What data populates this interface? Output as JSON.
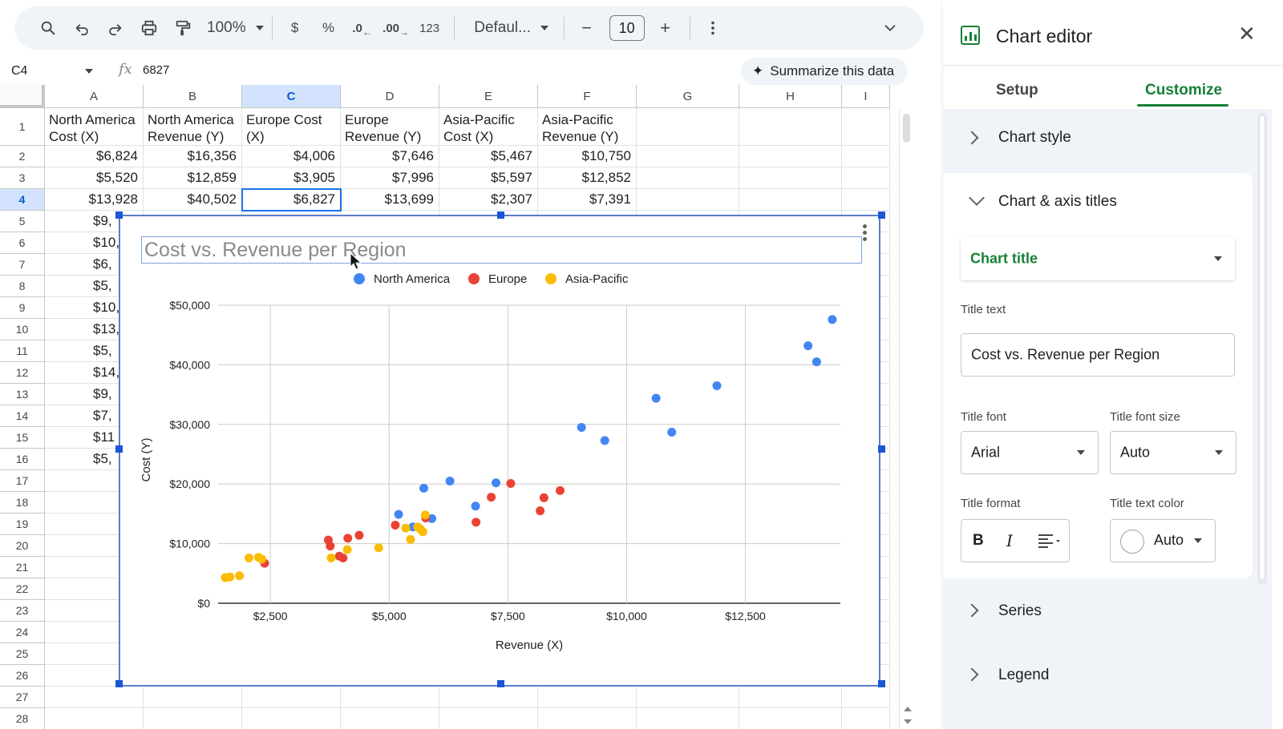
{
  "toolbar": {
    "zoom": "100%",
    "currency": "$",
    "percent": "%",
    "decrease_decimal": ".0",
    "increase_decimal": ".00",
    "number_format": "123",
    "font": "Defaul...",
    "font_size": "10",
    "minus": "−",
    "plus": "+"
  },
  "formula_bar": {
    "cell_ref": "C4",
    "fx": "fx",
    "value": "6827",
    "summarize": "Summarize this data"
  },
  "grid": {
    "columns": [
      "A",
      "B",
      "C",
      "D",
      "E",
      "F",
      "G",
      "H",
      "I"
    ],
    "rows": [
      "1",
      "2",
      "3",
      "4",
      "5",
      "6",
      "7",
      "8",
      "9",
      "10",
      "11",
      "12",
      "13",
      "14",
      "15",
      "16",
      "17",
      "18",
      "19",
      "20",
      "21",
      "22",
      "23",
      "24",
      "25",
      "26",
      "27",
      "28"
    ],
    "headers": [
      "North America Cost (X)",
      "North America Revenue (Y)",
      "Europe Cost (X)",
      "Europe Revenue (Y)",
      "Asia-Pacific Cost (X)",
      "Asia-Pacific Revenue (Y)"
    ],
    "data_rows": [
      [
        "$6,824",
        "$16,356",
        "$4,006",
        "$7,646",
        "$5,467",
        "$10,750"
      ],
      [
        "$5,520",
        "$12,859",
        "$3,905",
        "$7,996",
        "$5,597",
        "$12,852"
      ],
      [
        "$13,928",
        "$40,502",
        "$6,827",
        "$13,699",
        "$2,307",
        "$7,391"
      ]
    ],
    "col_a_partial": [
      "$9,",
      "$10,",
      "$6,",
      "$5,",
      "$10,",
      "$13,",
      "$5,",
      "$14,",
      "$9,",
      "$7,",
      "$11",
      "$5,"
    ]
  },
  "chart": {
    "title": "Cost vs. Revenue per Region",
    "legend": [
      "North America",
      "Europe",
      "Asia-Pacific"
    ]
  },
  "chart_data": {
    "type": "scatter",
    "title": "Cost vs. Revenue per Region",
    "xlabel": "Revenue (X)",
    "ylabel": "Cost (Y)",
    "xlim": [
      1400,
      14500
    ],
    "ylim": [
      0,
      50000
    ],
    "x_ticks": [
      2500,
      5000,
      7500,
      10000,
      12500
    ],
    "x_tick_labels": [
      "$2,500",
      "$5,000",
      "$7,500",
      "$10,000",
      "$12,500"
    ],
    "y_ticks": [
      0,
      10000,
      20000,
      30000,
      40000,
      50000
    ],
    "y_tick_labels": [
      "$0",
      "$10,000",
      "$20,000",
      "$30,000",
      "$40,000",
      "$50,000"
    ],
    "grid": true,
    "legend_position": "top",
    "colors": [
      "#4285f4",
      "#ea4335",
      "#fbbc04"
    ],
    "series": [
      {
        "name": "North America",
        "points": [
          [
            5200,
            14900
          ],
          [
            5500,
            12800
          ],
          [
            5730,
            19300
          ],
          [
            5900,
            14200
          ],
          [
            6280,
            20500
          ],
          [
            6820,
            16300
          ],
          [
            7250,
            20200
          ],
          [
            9050,
            29500
          ],
          [
            9540,
            27300
          ],
          [
            10620,
            34400
          ],
          [
            10950,
            28700
          ],
          [
            11900,
            36500
          ],
          [
            13820,
            43200
          ],
          [
            14000,
            40500
          ],
          [
            14330,
            47600
          ]
        ]
      },
      {
        "name": "Europe",
        "points": [
          [
            2380,
            6700
          ],
          [
            3720,
            10600
          ],
          [
            3760,
            9600
          ],
          [
            3950,
            7900
          ],
          [
            4030,
            7600
          ],
          [
            4130,
            10900
          ],
          [
            4370,
            11400
          ],
          [
            5130,
            13100
          ],
          [
            5770,
            14300
          ],
          [
            6830,
            13600
          ],
          [
            7150,
            17800
          ],
          [
            7560,
            20100
          ],
          [
            8180,
            15500
          ],
          [
            8260,
            17700
          ],
          [
            8600,
            18900
          ]
        ]
      },
      {
        "name": "Asia-Pacific",
        "points": [
          [
            1550,
            4300
          ],
          [
            1650,
            4400
          ],
          [
            1850,
            4600
          ],
          [
            2050,
            7600
          ],
          [
            2250,
            7700
          ],
          [
            2320,
            7400
          ],
          [
            3780,
            7600
          ],
          [
            4120,
            9000
          ],
          [
            4780,
            9300
          ],
          [
            5350,
            12600
          ],
          [
            5450,
            10700
          ],
          [
            5600,
            12800
          ],
          [
            5650,
            12500
          ],
          [
            5710,
            12000
          ],
          [
            5760,
            14800
          ]
        ]
      }
    ]
  },
  "editor": {
    "title": "Chart editor",
    "tabs": [
      "Setup",
      "Customize"
    ],
    "sections": {
      "chart_style": "Chart style",
      "chart_axis_titles": "Chart & axis titles",
      "series": "Series",
      "legend": "Legend"
    },
    "title_type": "Chart title",
    "title_text_label": "Title text",
    "title_text_value": "Cost vs. Revenue per Region",
    "title_font_label": "Title font",
    "title_font_value": "Arial",
    "title_font_size_label": "Title font size",
    "title_font_size_value": "Auto",
    "title_format_label": "Title format",
    "bold": "B",
    "italic": "I",
    "title_text_color_label": "Title text color",
    "title_text_color_value": "Auto"
  }
}
